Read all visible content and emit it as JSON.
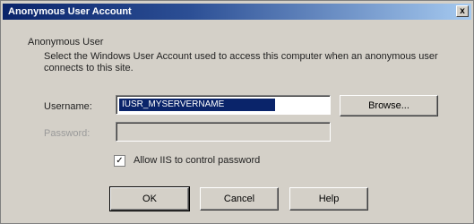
{
  "window": {
    "title": "Anonymous User Account",
    "close_glyph": "x"
  },
  "group": {
    "label": "Anonymous User",
    "description": "Select the Windows User Account used to access this computer when an anonymous user connects to this site."
  },
  "username": {
    "label": "Username:",
    "value": "IUSR_MYSERVERNAME"
  },
  "password": {
    "label": "Password:",
    "value": ""
  },
  "browse_label": "Browse...",
  "allow_iis": {
    "label": "Allow IIS to control password",
    "checked": true,
    "check_glyph": "✓"
  },
  "buttons": {
    "ok": "OK",
    "cancel": "Cancel",
    "help": "Help"
  }
}
